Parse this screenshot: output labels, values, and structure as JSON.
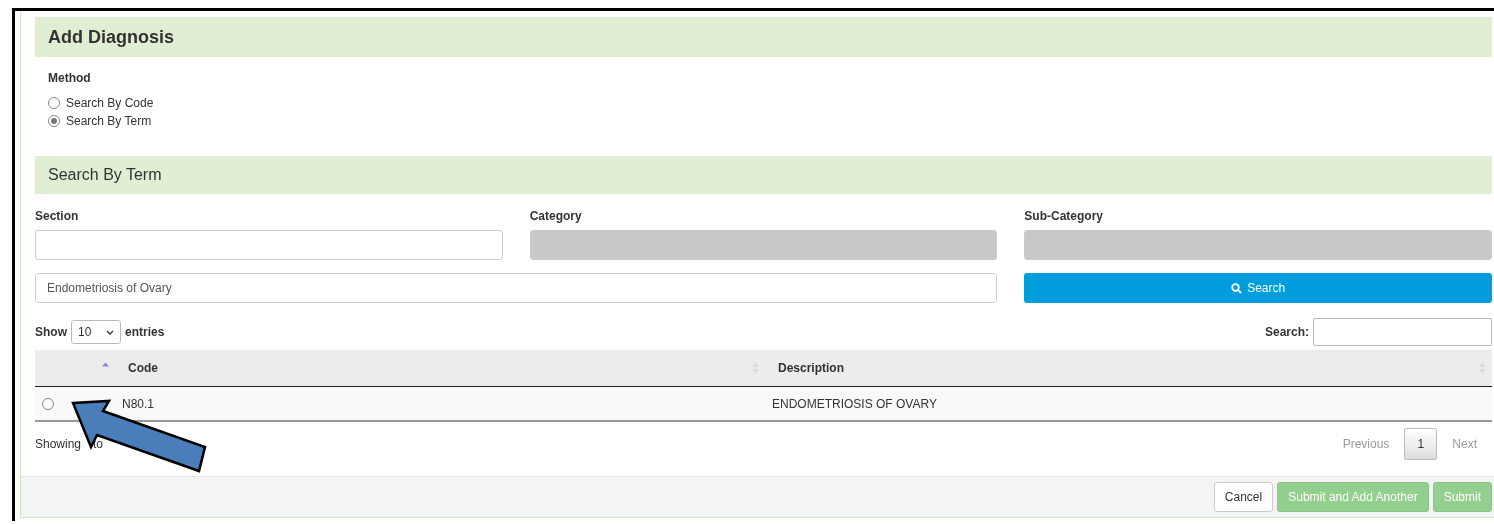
{
  "title": "Add Diagnosis",
  "method": {
    "label": "Method",
    "options": [
      {
        "label": "Search By Code",
        "selected": false
      },
      {
        "label": "Search By Term",
        "selected": true
      }
    ]
  },
  "search_panel": {
    "title": "Search By Term",
    "fields": [
      {
        "label": "Section",
        "disabled": false
      },
      {
        "label": "Category",
        "disabled": true
      },
      {
        "label": "Sub-Category",
        "disabled": true
      }
    ],
    "term": {
      "value": "Endometriosis of Ovary"
    },
    "search_button": "Search"
  },
  "table": {
    "show_label": "Show",
    "page_size": "10",
    "entries_label": "entries",
    "search_label": "Search:",
    "columns": [
      "Code",
      "Description"
    ],
    "rows": [
      {
        "selected": false,
        "code": "N80.1",
        "description": "ENDOMETRIOSIS OF OVARY"
      }
    ],
    "info_parts": [
      "Showing",
      "to"
    ],
    "pagination": {
      "previous": "Previous",
      "pages": [
        {
          "label": "1",
          "selected": true
        }
      ],
      "next": "Next"
    }
  },
  "footer": {
    "buttons": [
      {
        "label": "Cancel",
        "kind": "default"
      },
      {
        "label": "Submit and Add Another",
        "kind": "primary"
      },
      {
        "label": "Submit",
        "kind": "primary"
      }
    ]
  }
}
